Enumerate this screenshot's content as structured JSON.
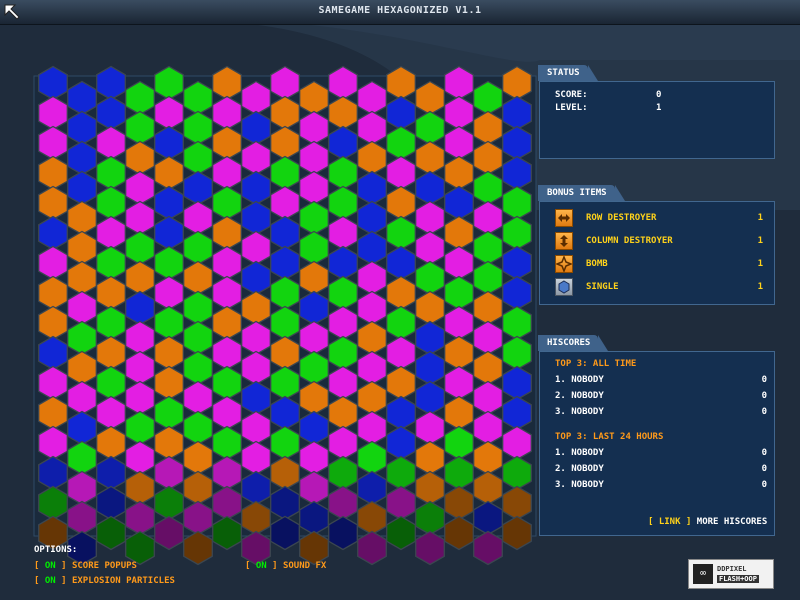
{
  "window": {
    "title": "SAMEGAME HEXAGONIZED V1.1"
  },
  "colors": {
    "background": "#1f2c3c",
    "panel": "#142f50",
    "tab": "#3f628a",
    "accent_yellow": "#ffd21a",
    "accent_orange": "#ff9a1a",
    "option_on": "#00ee00",
    "hex": {
      "M": "#e31ee3",
      "B": "#1126d6",
      "G": "#12d40f",
      "O": "#e3780a"
    }
  },
  "board": {
    "columns": 17,
    "rows": 16,
    "grid": [
      "BBBGGGOMMOMMOOMGO",
      "MBBGMGMBOMOMBGMOB",
      "MBMOBGOMOMBOGOMOB",
      "OBGMOBMBGMGBMBOGB",
      "OOGMBMGBMGGBOMBMG",
      "BOMGBGOMBGMBGMOGG",
      "MOGOGOMBBOBMBGMGB",
      "OMOBMGMOGBGMOOGOB",
      "OGGMGGOMGMMOGBMMG",
      "BOOMOGMMOGGMMBOOG",
      "MMGMOMGBGOMOOBMMB",
      "OBMGGGMMBBOMBMOMB",
      "MGOMOOGMGMMGBOGOM",
      "BMBOMOMBOMGBGOGOG",
      "GMBMGMMOBBMOMGOBO",
      "OBGGMOGMBOBMGMOMO"
    ]
  },
  "status": {
    "tab_label": "STATUS",
    "score_label": "SCORE:",
    "score_value": "0",
    "level_label": "LEVEL:",
    "level_value": "1"
  },
  "bonus_items": {
    "tab_label": "BONUS ITEMS",
    "items": [
      {
        "label": "ROW DESTROYER",
        "count": "1",
        "icon": "row-destroyer-icon"
      },
      {
        "label": "COLUMN DESTROYER",
        "count": "1",
        "icon": "column-destroyer-icon"
      },
      {
        "label": "BOMB",
        "count": "1",
        "icon": "bomb-icon"
      },
      {
        "label": "SINGLE",
        "count": "1",
        "icon": "single-icon"
      }
    ]
  },
  "hiscores": {
    "tab_label": "HISCORES",
    "all_time_title": "TOP 3: ALL TIME",
    "all_time": [
      {
        "name": "1. NOBODY",
        "score": "0"
      },
      {
        "name": "2. NOBODY",
        "score": "0"
      },
      {
        "name": "3. NOBODY",
        "score": "0"
      }
    ],
    "last24_title": "TOP 3: LAST 24 HOURS",
    "last24": [
      {
        "name": "1. NOBODY",
        "score": "0"
      },
      {
        "name": "2. NOBODY",
        "score": "0"
      },
      {
        "name": "3. NOBODY",
        "score": "0"
      }
    ],
    "link_open": "[",
    "link_word": "LINK",
    "link_close": "]",
    "more_label": "MORE HISCORES"
  },
  "options": {
    "title": "OPTIONS:",
    "score_popups": {
      "open": "[",
      "state": "ON",
      "close": "]",
      "label": "SCORE POPUPS"
    },
    "explosion_particles": {
      "open": "[",
      "state": "ON",
      "close": "]",
      "label": "EXPLOSION PARTICLES"
    },
    "sound_fx": {
      "open": "[",
      "state": "ON",
      "close": "]",
      "label": "SOUND FX"
    }
  },
  "logo": {
    "line1": "DDPIXEL",
    "line2": "FLASH+OOP",
    "icon": "infinity-logo-icon"
  }
}
